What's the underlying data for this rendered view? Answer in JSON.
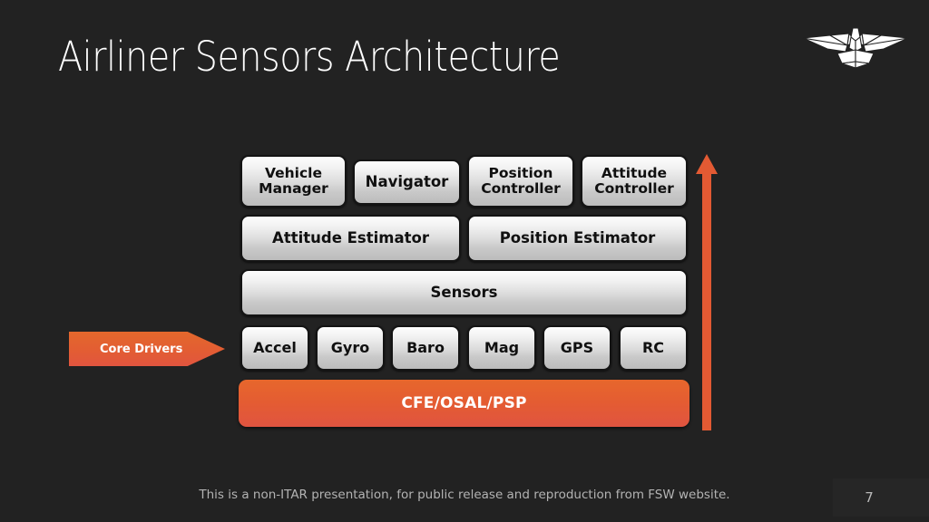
{
  "slide": {
    "title": "Airliner Sensors Architecture",
    "background_color": "#222222",
    "accent_color": "#E35A33",
    "page_number": "7",
    "footer_note": "This is a non-ITAR presentation, for public release and reproduction from FSW website."
  },
  "logo": {
    "name": "winged-bird-logo",
    "color": "#FFFFFF"
  },
  "diagram": {
    "rows": {
      "applications": [
        {
          "label_lines": [
            "Vehicle",
            "Manager"
          ],
          "name": "vehicle-manager"
        },
        {
          "label_lines": [
            "Navigator"
          ],
          "name": "navigator"
        },
        {
          "label_lines": [
            "Position",
            "Controller"
          ],
          "name": "position-controller"
        },
        {
          "label_lines": [
            "Attitude",
            "Controller"
          ],
          "name": "attitude-controller"
        }
      ],
      "estimators": [
        {
          "label_lines": [
            "Attitude Estimator"
          ],
          "name": "attitude-estimator"
        },
        {
          "label_lines": [
            "Position Estimator"
          ],
          "name": "position-estimator"
        }
      ],
      "sensors": [
        {
          "label_lines": [
            "Sensors"
          ],
          "name": "sensors"
        }
      ],
      "drivers": [
        {
          "label_lines": [
            "Accel"
          ],
          "name": "accel"
        },
        {
          "label_lines": [
            "Gyro"
          ],
          "name": "gyro"
        },
        {
          "label_lines": [
            "Baro"
          ],
          "name": "baro"
        },
        {
          "label_lines": [
            "Mag"
          ],
          "name": "mag"
        },
        {
          "label_lines": [
            "GPS"
          ],
          "name": "gps"
        },
        {
          "label_lines": [
            "RC"
          ],
          "name": "rc"
        }
      ],
      "platform": [
        {
          "label_lines": [
            "CFE/OSAL/PSP"
          ],
          "name": "cfe-osal-psp"
        }
      ]
    },
    "core_drivers_tag": "Core Drivers",
    "up_arrow": {
      "name": "layer-stack-up-arrow",
      "color": "#E35A33"
    }
  }
}
